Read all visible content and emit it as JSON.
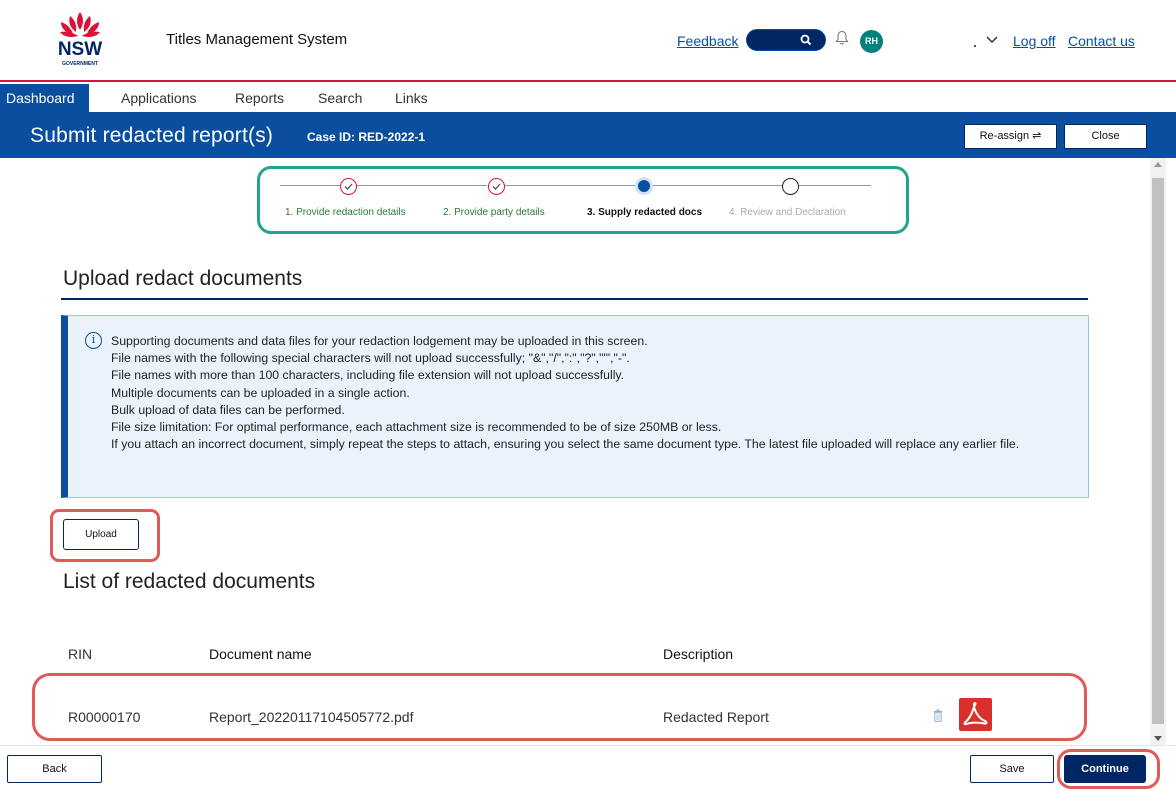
{
  "header": {
    "logo_text": "NSW",
    "logo_sub": "GOVERNMENT",
    "app_title": "Titles Management System",
    "feedback_label": "Feedback",
    "avatar_initials": "RH",
    "logoff_label": "Log off",
    "contact_label": "Contact us",
    "icons": [
      "search-icon",
      "bell-icon",
      "chevron-down-icon"
    ]
  },
  "nav": {
    "items": [
      "Dashboard",
      "Applications",
      "Reports",
      "Search",
      "Links"
    ],
    "active": "Dashboard"
  },
  "titlebar": {
    "title": "Submit redacted report(s)",
    "case_id": "Case ID: RED-2022-1",
    "reassign_label": "Re-assign ⇌",
    "close_label": "Close"
  },
  "stepper": {
    "steps": [
      {
        "label": "1. Provide redaction details",
        "state": "done"
      },
      {
        "label": "2. Provide party details",
        "state": "done"
      },
      {
        "label": "3. Supply redacted docs",
        "state": "current"
      },
      {
        "label": "4. Review and Declaration",
        "state": "todo"
      }
    ]
  },
  "upload_section": {
    "heading": "Upload redact documents",
    "info_lines": [
      "Supporting documents and data files for your redaction lodgement may be uploaded in this screen.",
      "File names with the following special characters will not upload successfully; \"&\",\"/\",\":\",\"?\",\"'\",\"-\".",
      "File names with more than 100 characters, including file extension will not upload successfully.",
      "Multiple documents can be uploaded in a single action.",
      "Bulk upload of data files can be performed.",
      "File size limitation: For optimal performance, each attachment size is recommended to be of size 250MB or less.",
      "If you attach an incorrect document, simply repeat the steps to attach, ensuring you select the same document type. The latest file uploaded will replace any earlier file."
    ],
    "upload_label": "Upload"
  },
  "list_section": {
    "heading": "List of redacted documents",
    "columns": [
      "RIN",
      "Document name",
      "Description"
    ],
    "rows": [
      {
        "rin": "R00000170",
        "document_name": "Report_20220117104505772.pdf",
        "description": "Redacted Report"
      }
    ]
  },
  "footer": {
    "back_label": "Back",
    "save_label": "Save",
    "continue_label": "Continue"
  },
  "colors": {
    "brand_blue": "#0a4e9f",
    "navy": "#002664",
    "nsw_red": "#d7153a",
    "highlight_red": "#e05a57",
    "highlight_teal": "#22a28f"
  }
}
